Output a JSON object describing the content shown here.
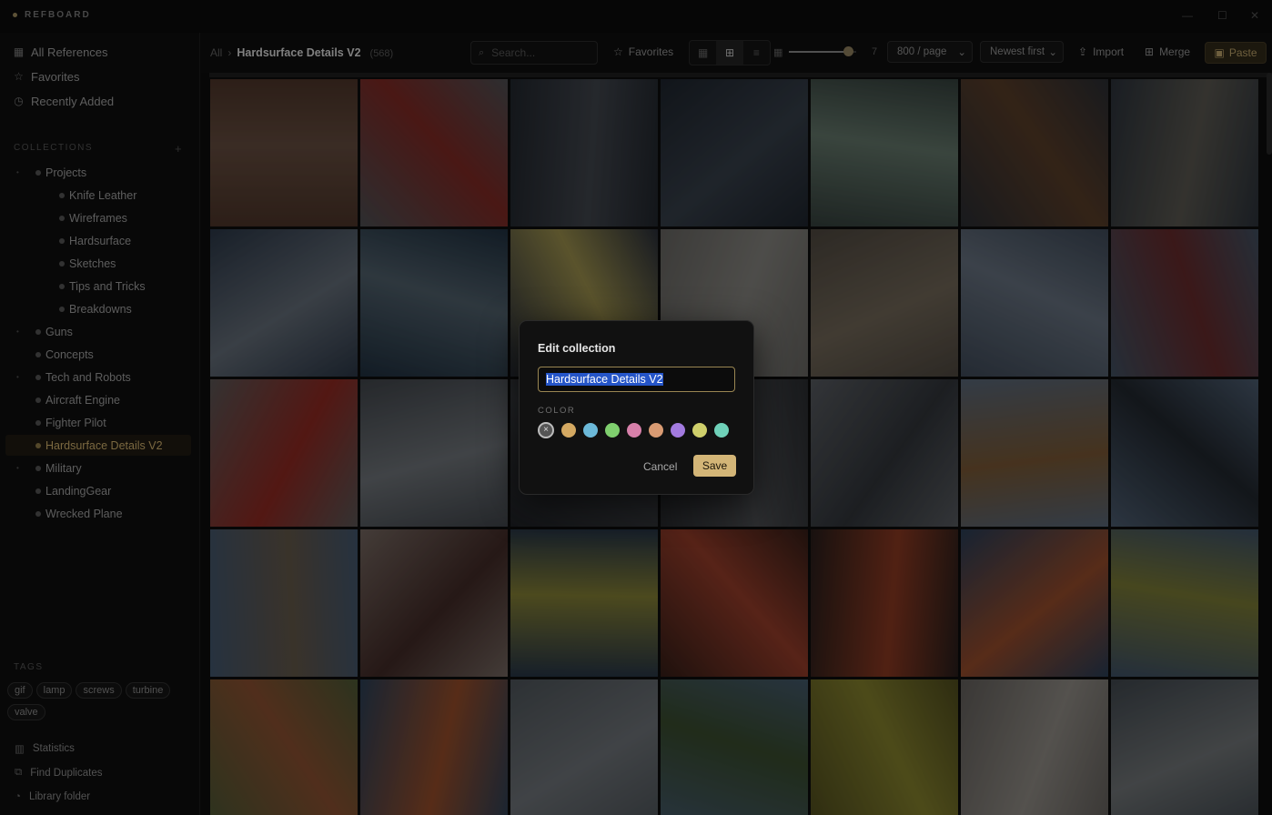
{
  "app": {
    "name": "REFBOARD"
  },
  "sidebar": {
    "nav": [
      {
        "label": "All References",
        "icon": "grid-icon"
      },
      {
        "label": "Favorites",
        "icon": "star-icon"
      },
      {
        "label": "Recently Added",
        "icon": "clock-icon"
      }
    ],
    "collections_label": "COLLECTIONS",
    "collections": [
      {
        "label": "Projects",
        "depth": 0,
        "has_children": true
      },
      {
        "label": "Knife Leather",
        "depth": 1
      },
      {
        "label": "Wireframes",
        "depth": 1
      },
      {
        "label": "Hardsurface",
        "depth": 1
      },
      {
        "label": "Sketches",
        "depth": 1
      },
      {
        "label": "Tips and Tricks",
        "depth": 1
      },
      {
        "label": "Breakdowns",
        "depth": 1
      },
      {
        "label": "Guns",
        "depth": 0,
        "has_children": true
      },
      {
        "label": "Concepts",
        "depth": 0
      },
      {
        "label": "Tech and Robots",
        "depth": 0,
        "has_children": true
      },
      {
        "label": "Aircraft Engine",
        "depth": 0
      },
      {
        "label": "Fighter Pilot",
        "depth": 0
      },
      {
        "label": "Hardsurface Details V2",
        "depth": 0,
        "active": true
      },
      {
        "label": "Military",
        "depth": 0,
        "has_children": true
      },
      {
        "label": "LandingGear",
        "depth": 0
      },
      {
        "label": "Wrecked Plane",
        "depth": 0
      }
    ],
    "tags_label": "TAGS",
    "tags": [
      "gif",
      "lamp",
      "screws",
      "turbine",
      "valve"
    ],
    "footer": [
      {
        "label": "Statistics",
        "icon": "bar-chart-icon"
      },
      {
        "label": "Find Duplicates",
        "icon": "copy-icon"
      },
      {
        "label": "Library folder",
        "icon": "folder-icon"
      }
    ]
  },
  "toolbar": {
    "breadcrumb_root": "All",
    "breadcrumb_sep": "›",
    "breadcrumb_current": "Hardsurface Details V2",
    "item_count": "(568)",
    "search_placeholder": "Search...",
    "favorites_label": "Favorites",
    "size_value": "7",
    "size_fraction": 0.88,
    "per_page": "800 / page",
    "sort": "Newest first",
    "import_label": "Import",
    "merge_label": "Merge",
    "paste_label": "Paste"
  },
  "grid": {
    "tiles": [
      [
        "#6b4a3a",
        "#8c6a58"
      ],
      [
        "#6c6e73",
        "#b03a33"
      ],
      [
        "#2f3640",
        "#5a606a"
      ],
      [
        "#2a3340",
        "#4c5866"
      ],
      [
        "#4a5a55",
        "#8aa594"
      ],
      [
        "#3c4048",
        "#7b5538"
      ],
      [
        "#3e4752",
        "#7d7a70"
      ],
      [
        "#3d4d63",
        "#8a97a6"
      ],
      [
        "#2c4358",
        "#6f8595"
      ],
      [
        "#3a4150",
        "#d8c86b"
      ],
      [
        "#8f8d88",
        "#b9b7b0"
      ],
      [
        "#6d6458",
        "#9c8e7a"
      ],
      [
        "#57667a",
        "#8e9db0"
      ],
      [
        "#5a6f86",
        "#8d3b3d"
      ],
      [
        "#7d7877",
        "#c6392f"
      ],
      [
        "#5a6068",
        "#9aa1a8"
      ],
      [
        "#2c2f35",
        "#55595f"
      ],
      [
        "#3a3d42",
        "#6a6d72"
      ],
      [
        "#7a7f86",
        "#454a51"
      ],
      [
        "#7a8fa7",
        "#a77a4a"
      ],
      [
        "#6a819c",
        "#2e3640"
      ],
      [
        "#5c7898",
        "#8a7b66"
      ],
      [
        "#a28f86",
        "#5b3b36"
      ],
      [
        "#364a62",
        "#b6b04a"
      ],
      [
        "#4b2a22",
        "#d0553a"
      ],
      [
        "#3a2a26",
        "#c2502f"
      ],
      [
        "#3a5578",
        "#d0693c"
      ],
      [
        "#56708e",
        "#a8a84a"
      ],
      [
        "#6b7c4a",
        "#c07044"
      ],
      [
        "#3d5878",
        "#d06b3a"
      ],
      [
        "#6d767d",
        "#9aa1a8"
      ],
      [
        "#5e7c94",
        "#4f6940"
      ],
      [
        "#6f6b2a",
        "#b7b23e"
      ],
      [
        "#8a8580",
        "#c9c3ba"
      ],
      [
        "#5a646d",
        "#9da3a6"
      ]
    ]
  },
  "modal": {
    "title": "Edit collection",
    "name_value": "Hardsurface Details V2",
    "color_label": "COLOR",
    "colors": [
      {
        "name": "none",
        "hex": "#555555",
        "selected": true
      },
      {
        "name": "gold",
        "hex": "#d4a962"
      },
      {
        "name": "blue",
        "hex": "#6cb9d9"
      },
      {
        "name": "green",
        "hex": "#7fcf6e"
      },
      {
        "name": "pink",
        "hex": "#d780aa"
      },
      {
        "name": "tan",
        "hex": "#d99b73"
      },
      {
        "name": "purple",
        "hex": "#a37be0"
      },
      {
        "name": "olive",
        "hex": "#cfcf6b"
      },
      {
        "name": "teal",
        "hex": "#6fd1b9"
      }
    ],
    "none_glyph": "×",
    "cancel_label": "Cancel",
    "save_label": "Save"
  }
}
